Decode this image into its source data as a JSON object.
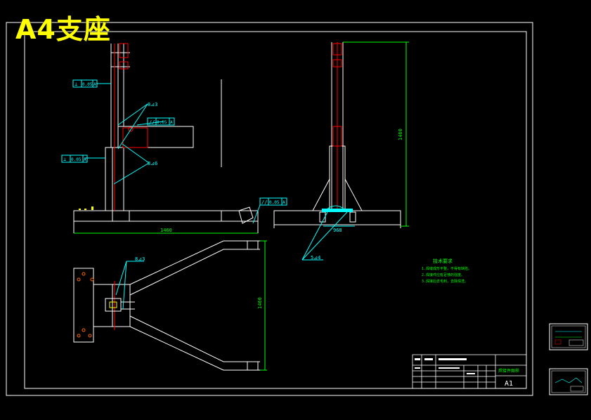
{
  "title": "A4支座",
  "dimensions": {
    "base_length": "1460",
    "height": "1460",
    "width": "968",
    "arm_length": "1460"
  },
  "tolerances": {
    "perp_top": [
      "⊥",
      "0.05",
      "A"
    ],
    "perp_mid": [
      "⊥",
      "0.05",
      "A"
    ],
    "parallel": [
      "//",
      "0.05",
      "A"
    ],
    "parallel_right": [
      "//",
      "0.05",
      "A"
    ]
  },
  "weld_labels": {
    "w1": "8⊿3",
    "w2": "8⊿6",
    "w3": "8⊿3",
    "w4": "5⊿4"
  },
  "tech_requirements": {
    "heading": "技术要求",
    "items": [
      "1.焊缝成形平整，不得有缺陷。",
      "2.焊接件应有足够的强度。",
      "3.焊接后去毛刺，去除焊渣。"
    ]
  },
  "title_block": {
    "drawing_name": "焊接件图样",
    "sheet_size": "A1"
  },
  "colors": {
    "background": "#000000",
    "frame": "#ffffff",
    "outline": "#ffffff",
    "dimension": "#00ff00",
    "annotation": "#00ffff",
    "centerline": "#ff0000",
    "title": "#ffff00",
    "tech_text": "#00ff00"
  }
}
